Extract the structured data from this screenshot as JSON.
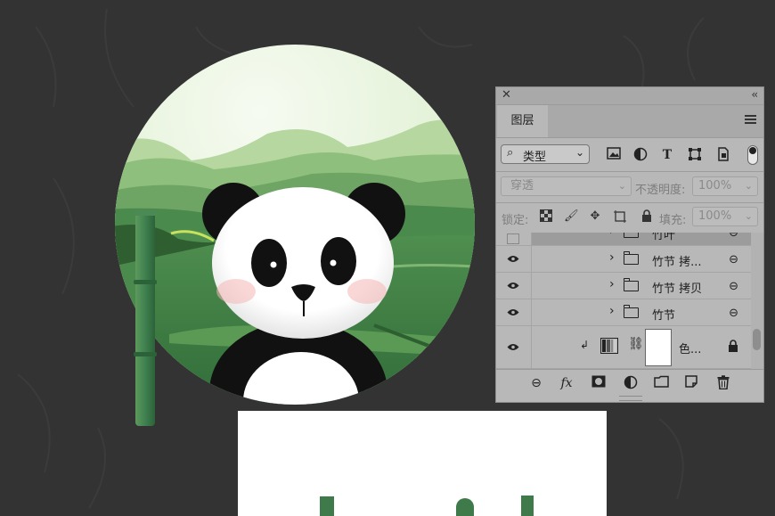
{
  "panel": {
    "tab_label": "图层",
    "close_glyph": "✕",
    "collapse_glyph": "‹‹",
    "filter": {
      "label": "类型",
      "search_icon": "search-icon",
      "chevron": "⌄"
    },
    "filter_icons": [
      "image-filter-icon",
      "adjustment-filter-icon",
      "text-filter-icon",
      "shape-filter-icon",
      "smart-object-filter-icon"
    ],
    "blend_mode": "穿透",
    "opacity_label": "不透明度:",
    "opacity_value": "100%",
    "lock_label": "锁定:",
    "fill_label": "填充:",
    "fill_value": "100%",
    "layers": [
      {
        "name": "竹叶",
        "visible": false,
        "type": "group"
      },
      {
        "name": "竹节 拷...",
        "visible": true,
        "type": "group"
      },
      {
        "name": "竹节 拷贝",
        "visible": true,
        "type": "group"
      },
      {
        "name": "竹节",
        "visible": true,
        "type": "group"
      },
      {
        "name": "色...",
        "visible": true,
        "type": "adjustment"
      }
    ],
    "fx_label": "fx",
    "colors": {
      "panel_bg": "#b8b8b8",
      "header_bg": "#a9a9a9",
      "selected_row": "#9a9a9a"
    }
  },
  "artwork": {
    "colors": {
      "sky": "#e6f2dc",
      "hill_light": "#a9cc92",
      "hill_mid": "#6ea565",
      "hill_dark": "#3f7a45",
      "bamboo": "#3f8050",
      "panda_black": "#111111"
    }
  }
}
